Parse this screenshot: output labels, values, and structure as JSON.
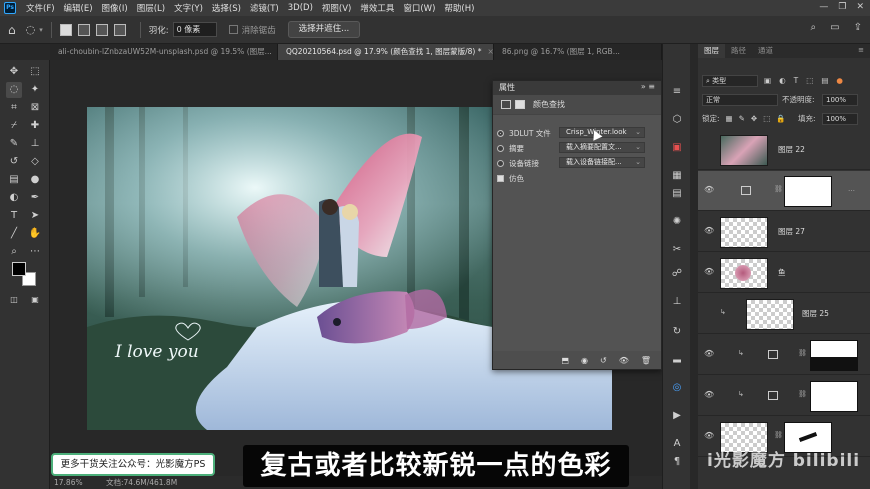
{
  "menubar": {
    "logo": "Ps",
    "items": [
      "文件(F)",
      "编辑(E)",
      "图像(I)",
      "图层(L)",
      "文字(Y)",
      "选择(S)",
      "滤镜(T)",
      "3D(D)",
      "视图(V)",
      "增效工具",
      "窗口(W)",
      "帮助(H)"
    ]
  },
  "options": {
    "feather_label": "羽化:",
    "feather_value": "0 像素",
    "antialias_label": "消除锯齿",
    "select_subject": "选择并遮住..."
  },
  "tabs": [
    {
      "label": "ali-choubin-lZnbzaUW52M-unsplash.psd @ 19.5% (图层...",
      "active": false
    },
    {
      "label": "QQ20210564.psd @ 17.9% (颜色查找 1, 图层蒙版/8) *",
      "active": true
    },
    {
      "label": "86.png @ 16.7% (图层 1, RGB...",
      "active": false
    }
  ],
  "canvas": {
    "photo_caption": "I love you"
  },
  "status": {
    "zoom": "17.86%",
    "doc": "文档:74.6M/461.8M"
  },
  "properties": {
    "title": "属性",
    "subtitle": "颜色查找",
    "rows": [
      {
        "label": "3DLUT 文件",
        "value": "Crisp_Winter.look",
        "selected": true
      },
      {
        "label": "摘要",
        "value": "载入摘要配置文...",
        "selected": false
      },
      {
        "label": "设备链接",
        "value": "载入设备链接配...",
        "selected": false
      }
    ],
    "dither_label": "仿色"
  },
  "layers_panel": {
    "tabs": [
      "图层",
      "路径",
      "通道"
    ],
    "kind_filter": "类型",
    "blend_mode": "正常",
    "opacity_label": "不透明度:",
    "opacity_value": "100%",
    "lock_label": "锁定:",
    "fill_label": "填充:",
    "fill_value": "100%",
    "layers": [
      {
        "name": "图层 22",
        "kind": "photo",
        "visible": false,
        "selected": false
      },
      {
        "name": "",
        "kind": "adjustment",
        "visible": true,
        "selected": true
      },
      {
        "name": "图层 27",
        "kind": "transparent",
        "visible": true,
        "selected": false
      },
      {
        "name": "鱼",
        "kind": "fish",
        "visible": true,
        "selected": false
      },
      {
        "name": "图层 25",
        "kind": "clipped",
        "visible": false,
        "selected": false
      },
      {
        "name": "",
        "kind": "adj-mask-dark",
        "visible": true,
        "selected": false
      },
      {
        "name": "",
        "kind": "adj-mask-white",
        "visible": true,
        "selected": false
      },
      {
        "name": "",
        "kind": "brush-mask",
        "visible": true,
        "selected": false
      }
    ]
  },
  "overlays": {
    "subtitle": "复古或者比较新锐一点的色彩",
    "promo": "更多干货关注公众号：光影魔方PS",
    "watermark": "i光影魔方 bilibili"
  },
  "colors": {
    "accent": "#31a8ff",
    "panel": "#535353",
    "promo_border": "#4caf7a"
  }
}
